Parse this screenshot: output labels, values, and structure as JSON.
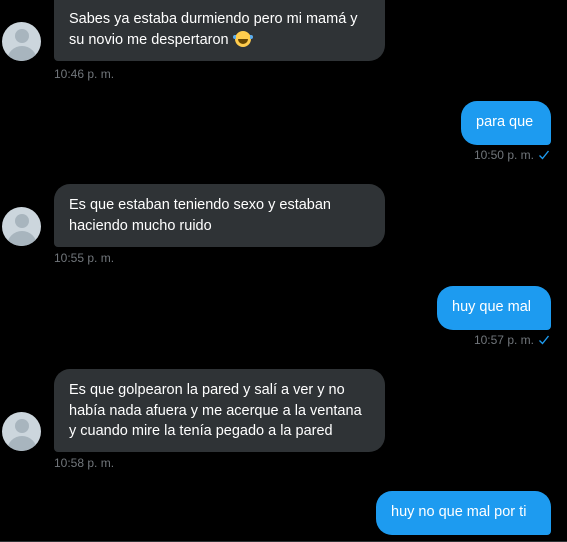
{
  "colors": {
    "background": "#000000",
    "incoming_bubble": "#2f3336",
    "outgoing_bubble": "#1d9bf0",
    "timestamp": "#71767b",
    "read_check": "#1d9bf0"
  },
  "messages": [
    {
      "direction": "incoming",
      "lines": [
        "Sabes ya estaba durmiendo pero mi mamá y",
        "su novio me despertaron"
      ],
      "emoji": "face-with-tears-of-joy-icon",
      "time": "10:46 p. m."
    },
    {
      "direction": "outgoing",
      "lines": [
        "para que"
      ],
      "time": "10:50 p. m.",
      "status_icon": "read-check-icon"
    },
    {
      "direction": "incoming",
      "lines": [
        "Es que estaban teniendo sexo y estaban",
        "haciendo mucho ruido"
      ],
      "time": "10:55 p. m."
    },
    {
      "direction": "outgoing",
      "lines": [
        "huy que mal"
      ],
      "time": "10:57 p. m.",
      "status_icon": "read-check-icon"
    },
    {
      "direction": "incoming",
      "lines": [
        "Es que golpearon la pared y salí a ver y no",
        "había nada afuera y me acerque a la ventana",
        "y cuando mire la tenía pegado a la pared"
      ],
      "time": "10:58 p. m."
    },
    {
      "direction": "outgoing",
      "lines": [
        "huy no que mal por ti"
      ]
    }
  ]
}
